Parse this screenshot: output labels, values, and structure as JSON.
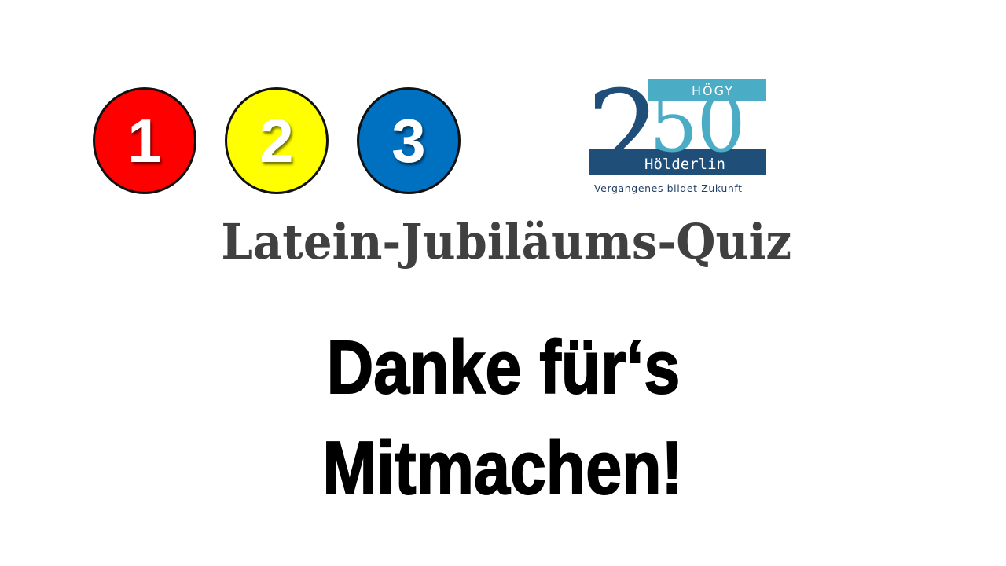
{
  "badges": [
    {
      "number": "1",
      "color": "#ff0000"
    },
    {
      "number": "2",
      "color": "#ffff00"
    },
    {
      "number": "3",
      "color": "#0070c0"
    }
  ],
  "logo": {
    "number_first": "2",
    "number_rest": "50",
    "school": "HÖGY",
    "name": "Hölderlin",
    "tagline": "Vergangenes bildet Zukunft",
    "color_dark": "#1f4e79",
    "color_light": "#4bacc6"
  },
  "subtitle": "Latein-Jubiläums-Quiz",
  "thanks": {
    "line1": "Danke für‘s",
    "line2": "Mitmachen!"
  }
}
